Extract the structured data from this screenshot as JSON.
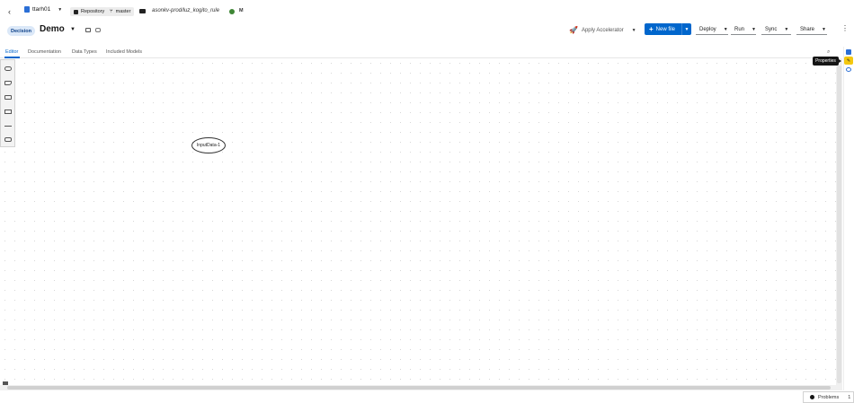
{
  "topbar": {
    "back_glyph": "‹",
    "user": "ttarh01",
    "repository_label": "Repository",
    "branch_label": "master",
    "path": "asonkv-prod/luz_kogito_rule",
    "modified_flag": "M"
  },
  "header": {
    "kind_badge": "Decision",
    "title": "Demo",
    "apply_accelerator": "Apply Accelerator",
    "new_file": "New file",
    "deploy": "Deploy",
    "run": "Run",
    "sync": "Sync",
    "share": "Share"
  },
  "tabs": [
    {
      "label": "Editor",
      "active": true
    },
    {
      "label": "Documentation",
      "active": false
    },
    {
      "label": "Data Types",
      "active": false
    },
    {
      "label": "Included Models",
      "active": false
    }
  ],
  "palette_icons": [
    "decision-icon",
    "input-data-icon",
    "knowledge-source-icon",
    "business-knowledge-icon",
    "decision-service-icon",
    "text-annotation-icon"
  ],
  "canvas": {
    "node_label": "InputData-1"
  },
  "right_panel": {
    "tooltip": "Properties"
  },
  "status": {
    "problems_label": "Problems",
    "problems_count": "1"
  },
  "colors": {
    "primary": "#0066cc",
    "badge_bg": "#dbe8f8",
    "success": "#3e8635",
    "highlight": "#f4c80f"
  }
}
